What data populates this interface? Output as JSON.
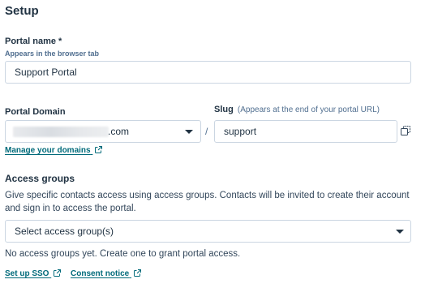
{
  "page": {
    "title": "Setup"
  },
  "portal_name": {
    "label": "Portal name *",
    "help": "Appears in the browser tab",
    "value": "Support Portal"
  },
  "portal_domain": {
    "label": "Portal Domain",
    "suffix": ".com",
    "separator": "/",
    "manage_link": "Manage your domains"
  },
  "slug": {
    "label": "Slug",
    "hint": "(Appears at the end of your portal URL)",
    "value": "support"
  },
  "access_groups": {
    "heading": "Access groups",
    "description": "Give specific contacts access using access groups. Contacts will be invited to create their account and sign in to access the portal.",
    "select_placeholder": "Select access group(s)",
    "empty_note": "No access groups yet. Create one to grant portal access."
  },
  "footer_links": {
    "sso": "Set up SSO",
    "consent": "Consent notice"
  },
  "colors": {
    "link": "#006a7a",
    "heading": "#213343",
    "border": "#cbd6e2"
  }
}
